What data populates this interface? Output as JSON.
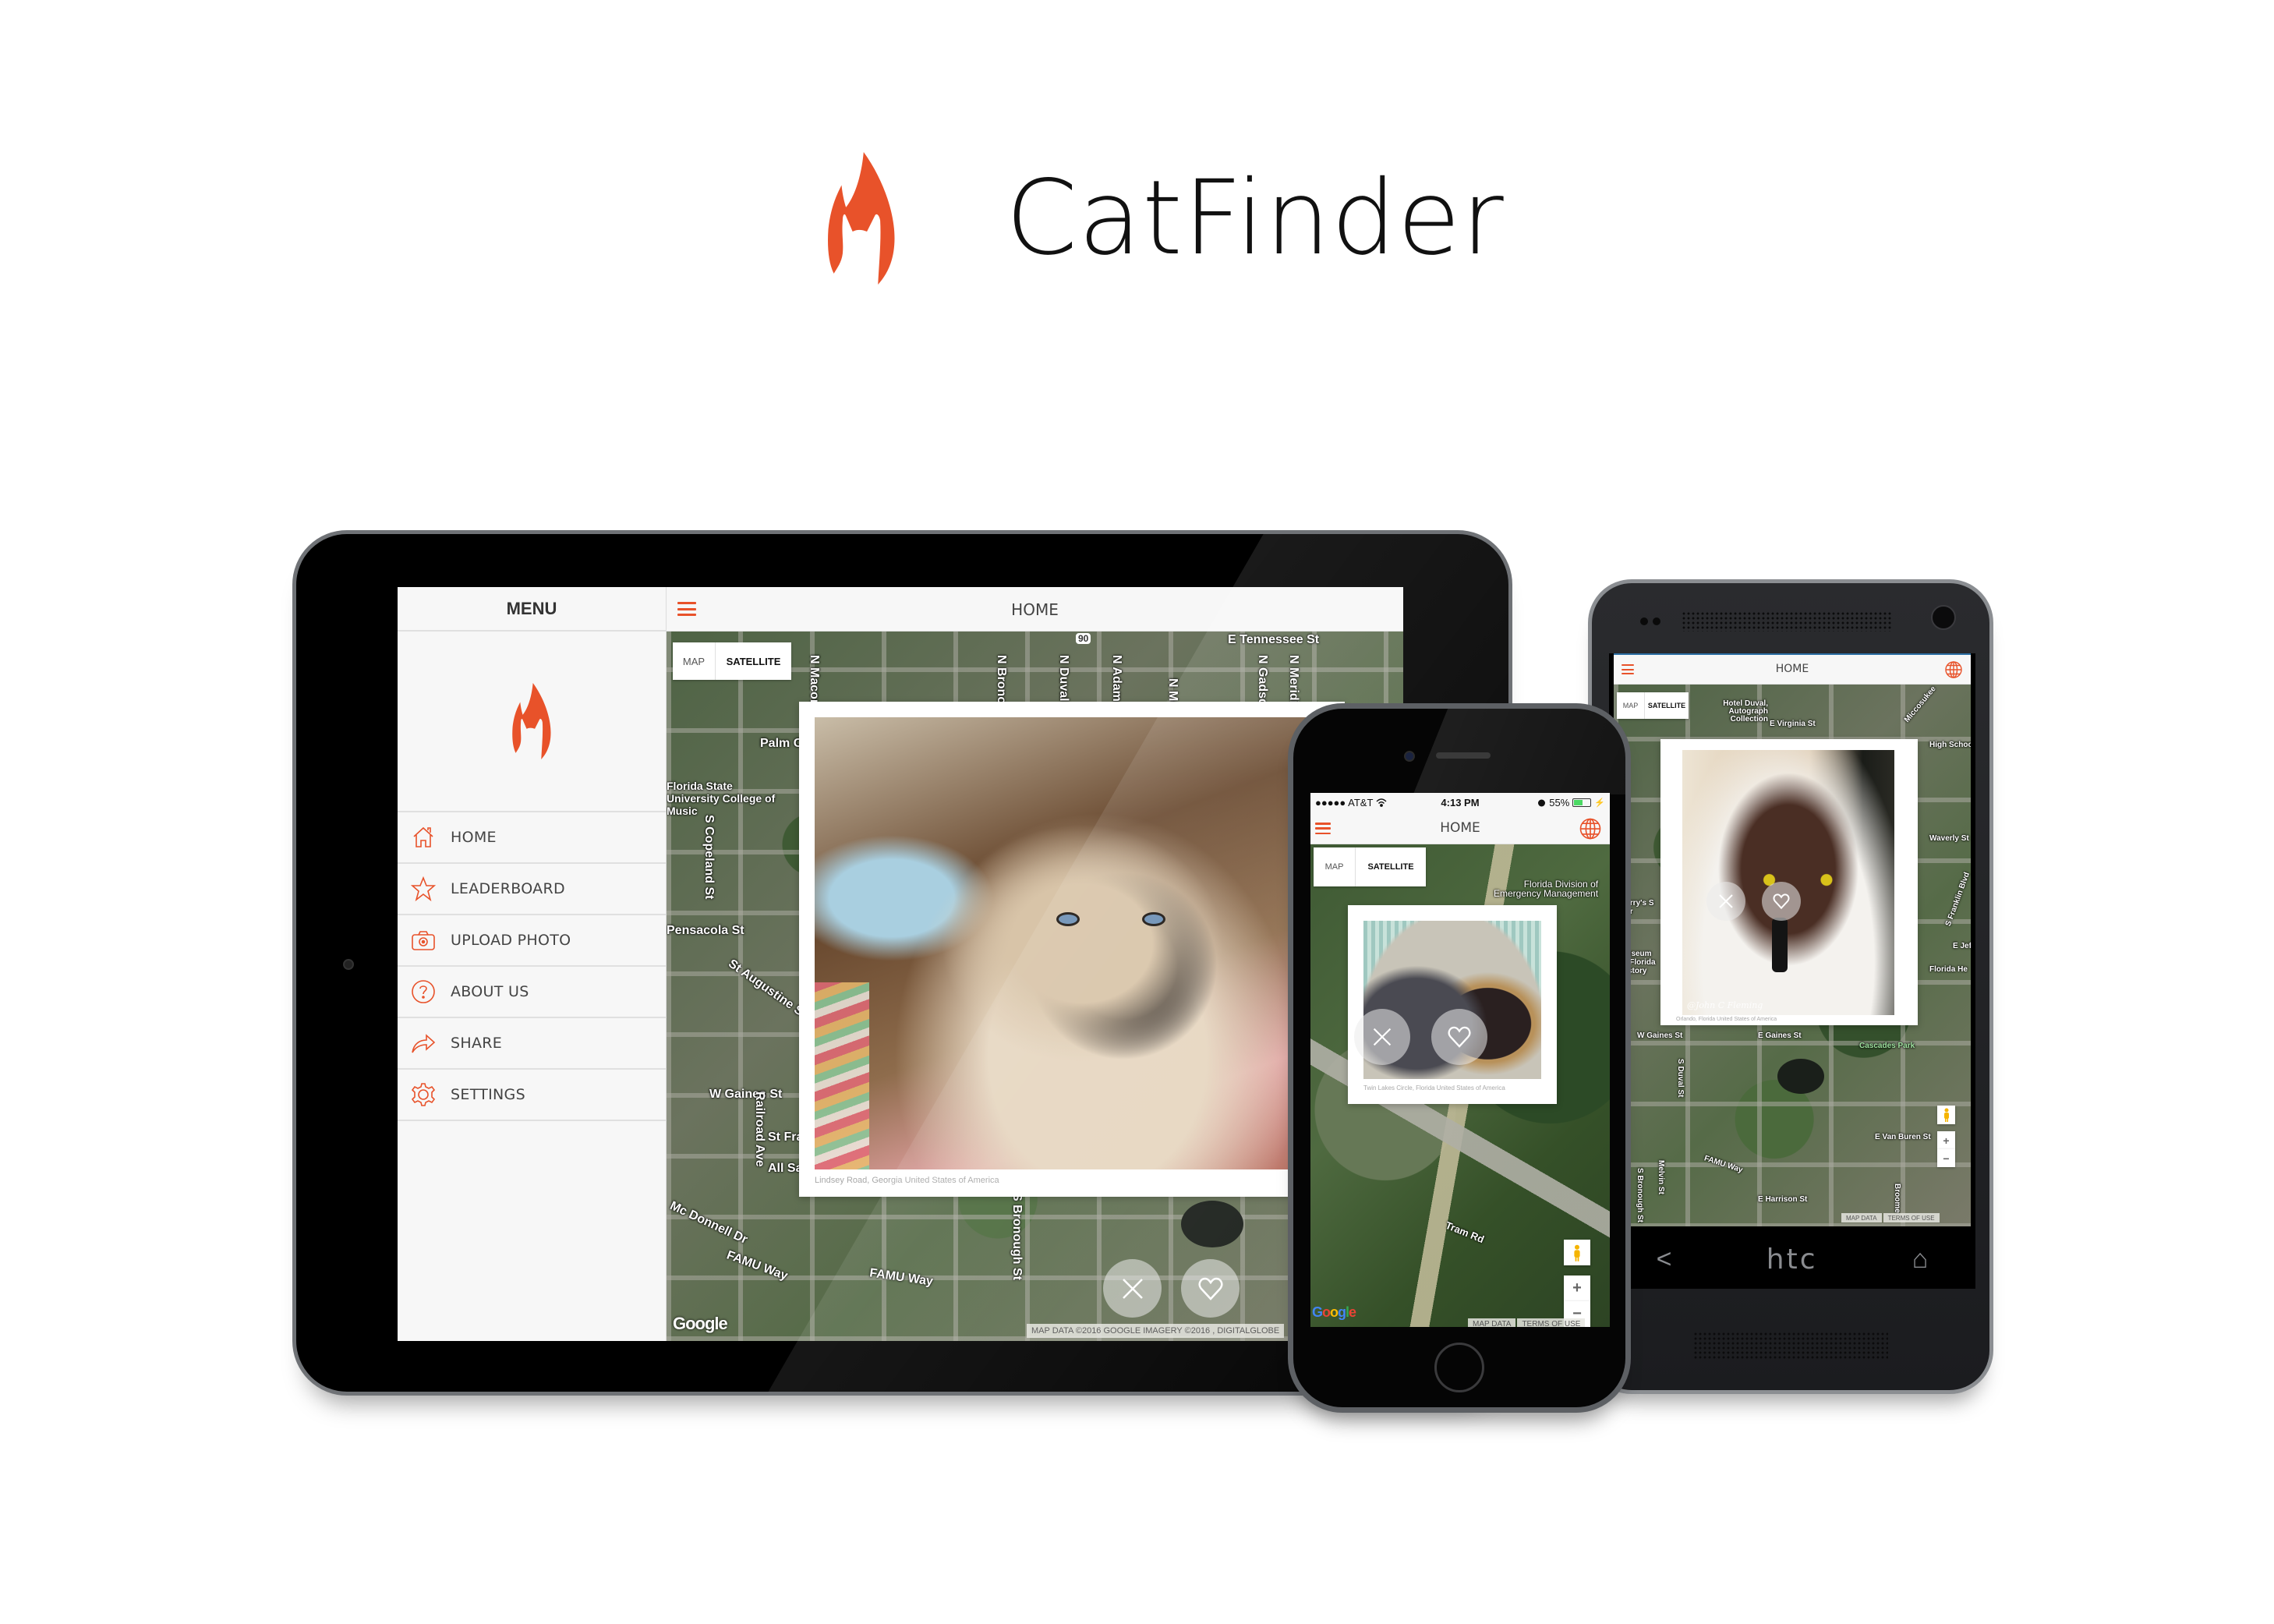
{
  "brand": {
    "name": "CatFinder",
    "accent_color": "#e8522a"
  },
  "tablet": {
    "menu": {
      "title": "MENU",
      "items": [
        {
          "label": "HOME",
          "icon": "home-icon"
        },
        {
          "label": "LEADERBOARD",
          "icon": "star-icon"
        },
        {
          "label": "UPLOAD PHOTO",
          "icon": "camera-icon"
        },
        {
          "label": "ABOUT US",
          "icon": "help-icon"
        },
        {
          "label": "SHARE",
          "icon": "share-icon"
        },
        {
          "label": "SETTINGS",
          "icon": "gear-icon"
        }
      ]
    },
    "header": {
      "title": "HOME"
    },
    "map": {
      "type_options": [
        "MAP",
        "SATELLITE"
      ],
      "selected_type": "SATELLITE",
      "labels": [
        "E Tennessee St",
        "N Macomb",
        "N Bronough",
        "N Duval",
        "N Adams",
        "N Monroe",
        "N Gadsden",
        "N Meridian",
        "Palm Ct",
        "Florida State University College of Music",
        "S Copeland St",
        "Pensacola St",
        "St Augustine St",
        "W Gaines St",
        "Railroad Ave",
        "St Francis",
        "All Saints St",
        "Mc Donnell Dr",
        "FAMU Way",
        "FAMU Way",
        "S Bronough St"
      ],
      "route_shield": "90",
      "google_logo": "Google",
      "attribution": "MAP DATA ©2016 GOOGLE IMAGERY ©2016 , DIGITALGLOBE"
    },
    "card": {
      "caption": "Lindsey Road, Georgia  United States of America",
      "photo_alt": "Himalayan cat"
    },
    "actions": {
      "dismiss": "close-icon",
      "like": "heart-icon"
    }
  },
  "iphone": {
    "status_bar": {
      "carrier": "●●●●● AT&T",
      "time": "4:13 PM",
      "battery": "55%",
      "battery_level": 0.55
    },
    "header": {
      "title": "HOME"
    },
    "map": {
      "type_options": [
        "MAP",
        "SATELLITE"
      ],
      "selected_type": "SATELLITE",
      "labels": [
        "Florida Division of",
        "Emergency Management",
        "Tram Rd"
      ],
      "google_logo": "Google",
      "map_data": "MAP DATA",
      "terms": "TERMS OF USE",
      "zoom_in": "+",
      "zoom_out": "−"
    },
    "card": {
      "caption": "Twin Lakes Circle, Florida  United States of America",
      "photo_alt": "Two cats sleeping in bed"
    }
  },
  "htc": {
    "header": {
      "title": "HOME"
    },
    "map": {
      "type_options": [
        "MAP",
        "SATELLITE"
      ],
      "selected_type": "SATELLITE",
      "labels": [
        "Hotel Duval, Autograph Collection",
        "E Virginia St",
        "Miccosukee",
        "High School",
        "Waverly St",
        "S Franklin Blvd",
        "E Jeff",
        "Florida He",
        "Harry's S Bar",
        "Museum of Florida History",
        "W Gaines St",
        "E Gaines St",
        "Cascades Park",
        "S Duval St",
        "E Van Buren St",
        "FAMU Way",
        "Melvin St",
        "S Bronough St",
        "E Harrison St",
        "Broome"
      ],
      "map_data": "MAP DATA",
      "terms": "TERMS OF USE",
      "zoom_in": "+",
      "zoom_out": "−"
    },
    "card": {
      "caption": "Orlando, Florida  United States of America",
      "watermark": "@John C Fleming",
      "photo_alt": "White and brown cat"
    },
    "nav": {
      "back": "<",
      "brand": "htc",
      "home": "⌂"
    }
  }
}
